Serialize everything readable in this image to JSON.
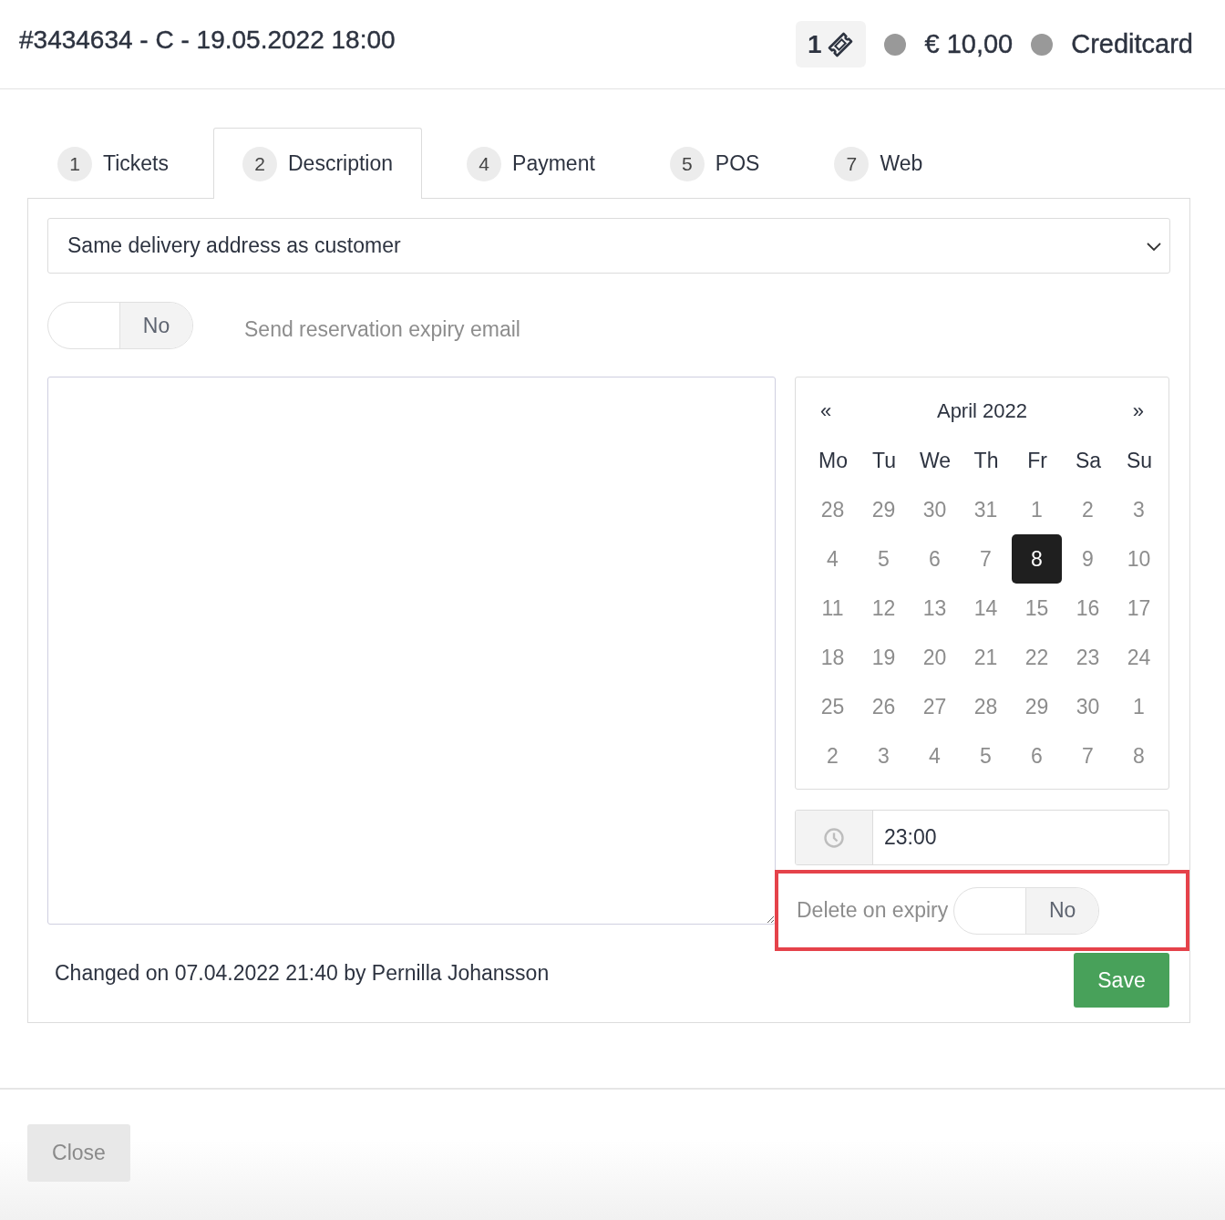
{
  "header": {
    "title": "#3434634 - C - 19.05.2022 18:00",
    "ticket_count": "1",
    "amount": "€ 10,00",
    "payment_method": "Creditcard"
  },
  "tabs": [
    {
      "number": "1",
      "label": "Tickets",
      "selected": false
    },
    {
      "number": "2",
      "label": "Description",
      "selected": true
    },
    {
      "number": "4",
      "label": "Payment",
      "selected": false
    },
    {
      "number": "5",
      "label": "POS",
      "selected": false
    },
    {
      "number": "7",
      "label": "Web",
      "selected": false
    }
  ],
  "delivery_select": {
    "value": "Same delivery address as customer"
  },
  "expiry_email": {
    "on": false,
    "state_label": "No",
    "label": "Send reservation expiry email"
  },
  "calendar": {
    "prev": "«",
    "month": "April 2022",
    "next": "»",
    "weekdays": [
      "Mo",
      "Tu",
      "We",
      "Th",
      "Fr",
      "Sa",
      "Su"
    ],
    "weeks": [
      [
        {
          "day": "28",
          "selected": false
        },
        {
          "day": "29",
          "selected": false
        },
        {
          "day": "30",
          "selected": false
        },
        {
          "day": "31",
          "selected": false
        },
        {
          "day": "1",
          "selected": false
        },
        {
          "day": "2",
          "selected": false
        },
        {
          "day": "3",
          "selected": false
        }
      ],
      [
        {
          "day": "4",
          "selected": false
        },
        {
          "day": "5",
          "selected": false
        },
        {
          "day": "6",
          "selected": false
        },
        {
          "day": "7",
          "selected": false
        },
        {
          "day": "8",
          "selected": true
        },
        {
          "day": "9",
          "selected": false
        },
        {
          "day": "10",
          "selected": false
        }
      ],
      [
        {
          "day": "11",
          "selected": false
        },
        {
          "day": "12",
          "selected": false
        },
        {
          "day": "13",
          "selected": false
        },
        {
          "day": "14",
          "selected": false
        },
        {
          "day": "15",
          "selected": false
        },
        {
          "day": "16",
          "selected": false
        },
        {
          "day": "17",
          "selected": false
        }
      ],
      [
        {
          "day": "18",
          "selected": false
        },
        {
          "day": "19",
          "selected": false
        },
        {
          "day": "20",
          "selected": false
        },
        {
          "day": "21",
          "selected": false
        },
        {
          "day": "22",
          "selected": false
        },
        {
          "day": "23",
          "selected": false
        },
        {
          "day": "24",
          "selected": false
        }
      ],
      [
        {
          "day": "25",
          "selected": false
        },
        {
          "day": "26",
          "selected": false
        },
        {
          "day": "27",
          "selected": false
        },
        {
          "day": "28",
          "selected": false
        },
        {
          "day": "29",
          "selected": false
        },
        {
          "day": "30",
          "selected": false
        },
        {
          "day": "1",
          "selected": false
        }
      ],
      [
        {
          "day": "2",
          "selected": false
        },
        {
          "day": "3",
          "selected": false
        },
        {
          "day": "4",
          "selected": false
        },
        {
          "day": "5",
          "selected": false
        },
        {
          "day": "6",
          "selected": false
        },
        {
          "day": "7",
          "selected": false
        },
        {
          "day": "8",
          "selected": false
        }
      ]
    ]
  },
  "time_field": {
    "value": "23:00"
  },
  "delete_on_expiry": {
    "label": "Delete on expiry",
    "on": false,
    "state_label": "No",
    "highlighted": true
  },
  "changed_note": "Changed on 07.04.2022 21:40 by Pernilla Johansson",
  "save_button": "Save",
  "close_button": "Close"
}
